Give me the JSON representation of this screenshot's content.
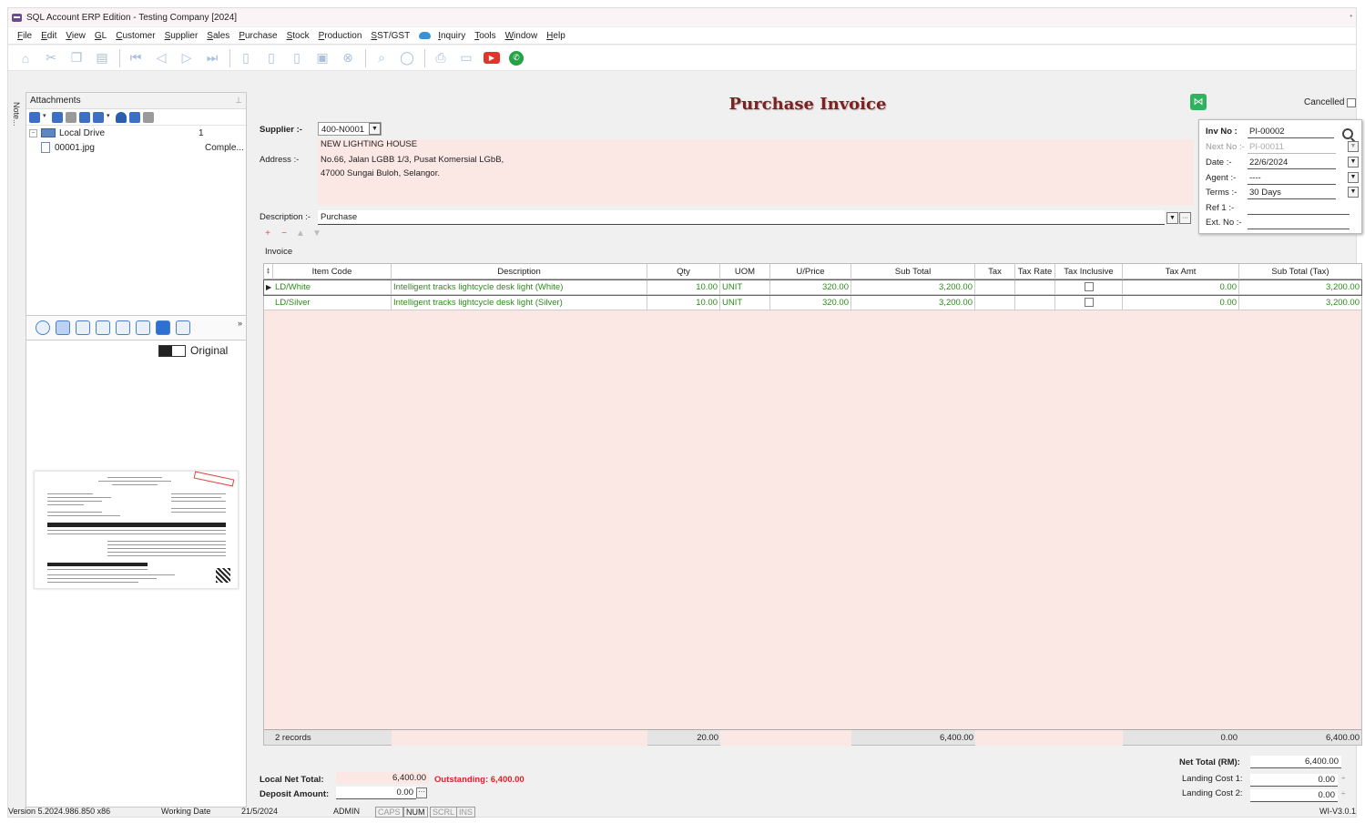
{
  "window": {
    "title": "SQL Account ERP Edition - Testing Company [2024]"
  },
  "menu": [
    "File",
    "Edit",
    "View",
    "GL",
    "Customer",
    "Supplier",
    "Sales",
    "Purchase",
    "Stock",
    "Production",
    "SST/GST",
    "Inquiry",
    "Tools",
    "Window",
    "Help"
  ],
  "note_tab": "Note...",
  "attachments": {
    "title": "Attachments",
    "tree": [
      {
        "name": "Local Drive",
        "count": "1"
      },
      {
        "name": "00001.jpg",
        "status": "Comple..."
      }
    ]
  },
  "viewer": {
    "toggle_label": "Original"
  },
  "form": {
    "title": "Purchase Invoice",
    "cancelled_label": "Cancelled",
    "supplier_label": "Supplier :-",
    "supplier_code": "400-N0001",
    "supplier_name": "NEW LIGHTING HOUSE",
    "address_label": "Address :-",
    "address_line1": "No.66, Jalan LGBB 1/3, Pusat Komersial LGbB,",
    "address_line2": "47000 Sungai Buloh, Selangor.",
    "description_label": "Description :-",
    "description": "Purchase",
    "tab_label": "Invoice"
  },
  "info": {
    "inv_no_label": "Inv No :",
    "inv_no": "PI-00002",
    "next_no_label": "Next No :-",
    "next_no": "PI-00011",
    "date_label": "Date :-",
    "date": "22/6/2024",
    "agent_label": "Agent :-",
    "agent": "----",
    "terms_label": "Terms :-",
    "terms": "30 Days",
    "ref1_label": "Ref 1 :-",
    "ref1": "",
    "ext_no_label": "Ext. No :-",
    "ext_no": ""
  },
  "grid": {
    "columns": [
      "Item Code",
      "Description",
      "Qty",
      "UOM",
      "U/Price",
      "Sub Total",
      "Tax",
      "Tax Rate",
      "Tax Inclusive",
      "Tax Amt",
      "Sub Total (Tax)"
    ],
    "rows": [
      {
        "item_code": "LD/White",
        "description": "Intelligent tracks lightcycle desk light (White)",
        "qty": "10.00",
        "uom": "UNIT",
        "uprice": "320.00",
        "subtotal": "3,200.00",
        "tax": "",
        "tax_rate": "",
        "tax_amt": "0.00",
        "subtotal_tax": "3,200.00"
      },
      {
        "item_code": "LD/Silver",
        "description": "Intelligent tracks lightcycle desk light (Silver)",
        "qty": "10.00",
        "uom": "UNIT",
        "uprice": "320.00",
        "subtotal": "3,200.00",
        "tax": "",
        "tax_rate": "",
        "tax_amt": "0.00",
        "subtotal_tax": "3,200.00"
      }
    ],
    "footer": {
      "records": "2 records",
      "qty": "20.00",
      "subtotal": "6,400.00",
      "tax_amt": "0.00",
      "subtotal_tax": "6,400.00"
    }
  },
  "totals": {
    "local_net_total_label": "Local Net Total:",
    "local_net_total": "6,400.00",
    "outstanding": "Outstanding: 6,400.00",
    "deposit_label": "Deposit Amount:",
    "deposit": "0.00",
    "net_total_label": "Net Total (RM):",
    "net_total": "6,400.00",
    "landing1_label": "Landing Cost 1:",
    "landing1": "0.00",
    "landing2_label": "Landing Cost 2:",
    "landing2": "0.00"
  },
  "status": {
    "version": "Version 5.2024.986.850 x86",
    "working_date_label": "Working Date",
    "working_date": "21/5/2024",
    "user": "ADMIN",
    "caps": "CAPS",
    "num": "NUM",
    "scrl": "SCRL",
    "ins": "INS",
    "right": "WI-V3.0.1"
  },
  "colors": {
    "accent_pink": "#fbe7e3",
    "title_red": "#7a2222",
    "grid_green": "#2e8a1e",
    "outstanding_red": "#e0202a"
  }
}
